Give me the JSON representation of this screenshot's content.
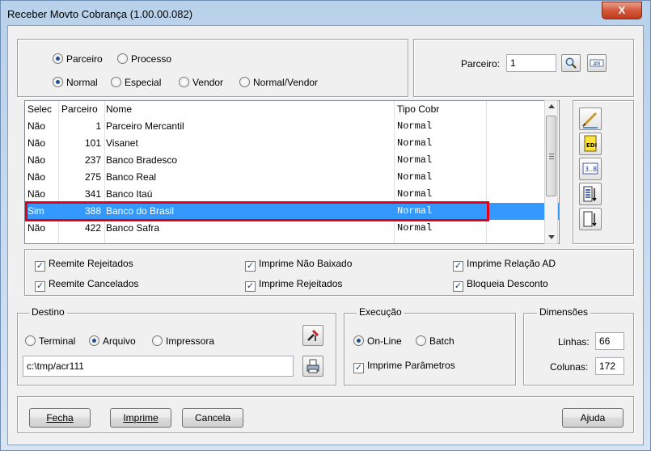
{
  "window": {
    "title": "Receber Movto Cobrança (1.00.00.082)",
    "close_label": "X"
  },
  "mode": {
    "options": [
      "Parceiro",
      "Processo"
    ],
    "selected": "Parceiro",
    "type_options": [
      "Normal",
      "Especial",
      "Vendor",
      "Normal/Vendor"
    ],
    "type_selected": "Normal"
  },
  "parceiro_filter": {
    "label": "Parceiro:",
    "value": "1"
  },
  "grid": {
    "columns": [
      "Selec",
      "Parceiro",
      "Nome",
      "Tipo Cobr"
    ],
    "rows": [
      {
        "selec": "Não",
        "parceiro": "1",
        "nome": "Parceiro Mercantil",
        "tipo": "Normal"
      },
      {
        "selec": "Não",
        "parceiro": "101",
        "nome": "Visanet",
        "tipo": "Normal"
      },
      {
        "selec": "Não",
        "parceiro": "237",
        "nome": "Banco Bradesco",
        "tipo": "Normal"
      },
      {
        "selec": "Não",
        "parceiro": "275",
        "nome": "Banco Real",
        "tipo": "Normal"
      },
      {
        "selec": "Não",
        "parceiro": "341",
        "nome": "Banco Itaú",
        "tipo": "Normal"
      },
      {
        "selec": "Sim",
        "parceiro": "388",
        "nome": "Banco do Brasil",
        "tipo": "Normal"
      },
      {
        "selec": "Não",
        "parceiro": "422",
        "nome": "Banco Safra",
        "tipo": "Normal"
      }
    ],
    "selected_row": 5
  },
  "options": {
    "reemite_rejeitados": "Reemite Rejeitados",
    "reemite_cancelados": "Reemite Cancelados",
    "imprime_nao_baixado": "Imprime Não Baixado",
    "imprime_rejeitados": "Imprime Rejeitados",
    "imprime_relacao_ad": "Imprime Relação AD",
    "bloqueia_desconto": "Bloqueia Desconto"
  },
  "destino": {
    "legend": "Destino",
    "options": [
      "Terminal",
      "Arquivo",
      "Impressora"
    ],
    "selected": "Arquivo",
    "path": "c:\\tmp/acr111"
  },
  "execucao": {
    "legend": "Execução",
    "options": [
      "On-Line",
      "Batch"
    ],
    "selected": "On-Line",
    "imprime_parametros": "Imprime Parâmetros"
  },
  "dimensoes": {
    "legend": "Dimensões",
    "linhas_label": "Linhas:",
    "linhas_value": "66",
    "colunas_label": "Colunas:",
    "colunas_value": "172"
  },
  "buttons": {
    "fecha": "Fecha",
    "imprime": "Imprime",
    "cancela": "Cancela",
    "ajuda": "Ajuda"
  },
  "colors": {
    "selection": "#3399ff",
    "highlight_border": "#e3001b"
  }
}
